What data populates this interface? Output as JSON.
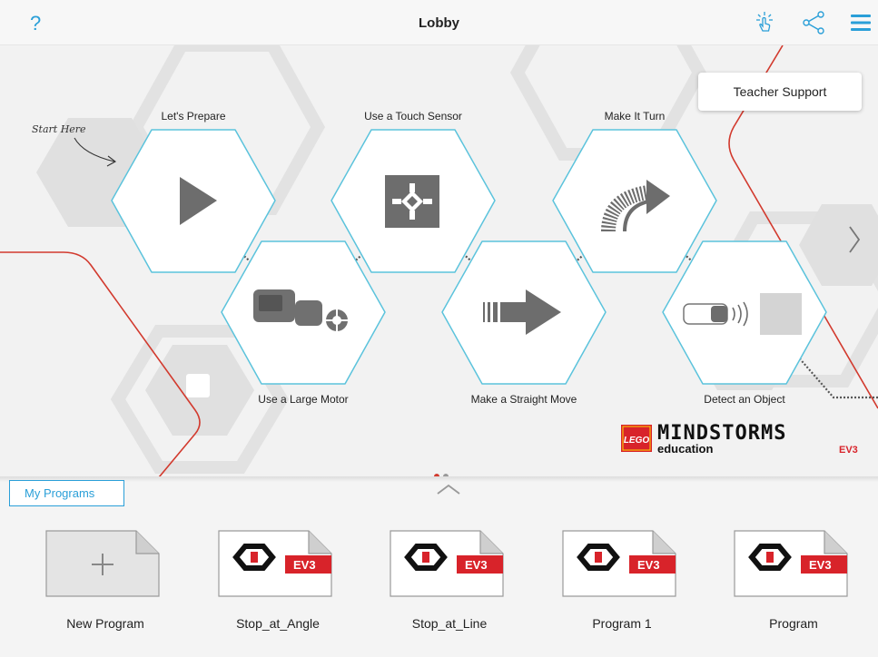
{
  "header": {
    "title": "Lobby",
    "help_glyph": "?"
  },
  "icons": {
    "help": "help-icon",
    "touch": "touch-gesture-icon",
    "share": "share-icon",
    "menu": "hamburger-menu-icon",
    "next": "chevron-right-icon",
    "collapse": "chevron-up-icon"
  },
  "teacher_support": "Teacher Support",
  "start_here": "Start Here",
  "lessons": [
    {
      "label": "Let's Prepare",
      "icon": "play-icon"
    },
    {
      "label": "Use a Large Motor",
      "icon": "large-motor-icon"
    },
    {
      "label": "Use a Touch Sensor",
      "icon": "touch-sensor-icon"
    },
    {
      "label": "Make a Straight Move",
      "icon": "straight-arrow-icon"
    },
    {
      "label": "Make It Turn",
      "icon": "turn-arrow-icon"
    },
    {
      "label": "Detect an Object",
      "icon": "ultrasonic-sensor-icon"
    }
  ],
  "logo": {
    "brand": "LEGO",
    "product": "mindstorms",
    "sub": "education",
    "edition": "EV3"
  },
  "pagination": {
    "current": 1,
    "total": 2
  },
  "my_programs": {
    "tab_label": "My Programs",
    "items": [
      {
        "label": "New Program",
        "badge": ""
      },
      {
        "label": "Stop_at_Angle",
        "badge": "EV3"
      },
      {
        "label": "Stop_at_Line",
        "badge": "EV3"
      },
      {
        "label": "Program 1",
        "badge": "EV3"
      },
      {
        "label": "Program",
        "badge": "EV3"
      }
    ]
  },
  "colors": {
    "accent": "#2a9fd8",
    "hex_outline": "#5bc3dc",
    "red_line": "#d23a2e",
    "ev3_red": "#d8232a"
  }
}
